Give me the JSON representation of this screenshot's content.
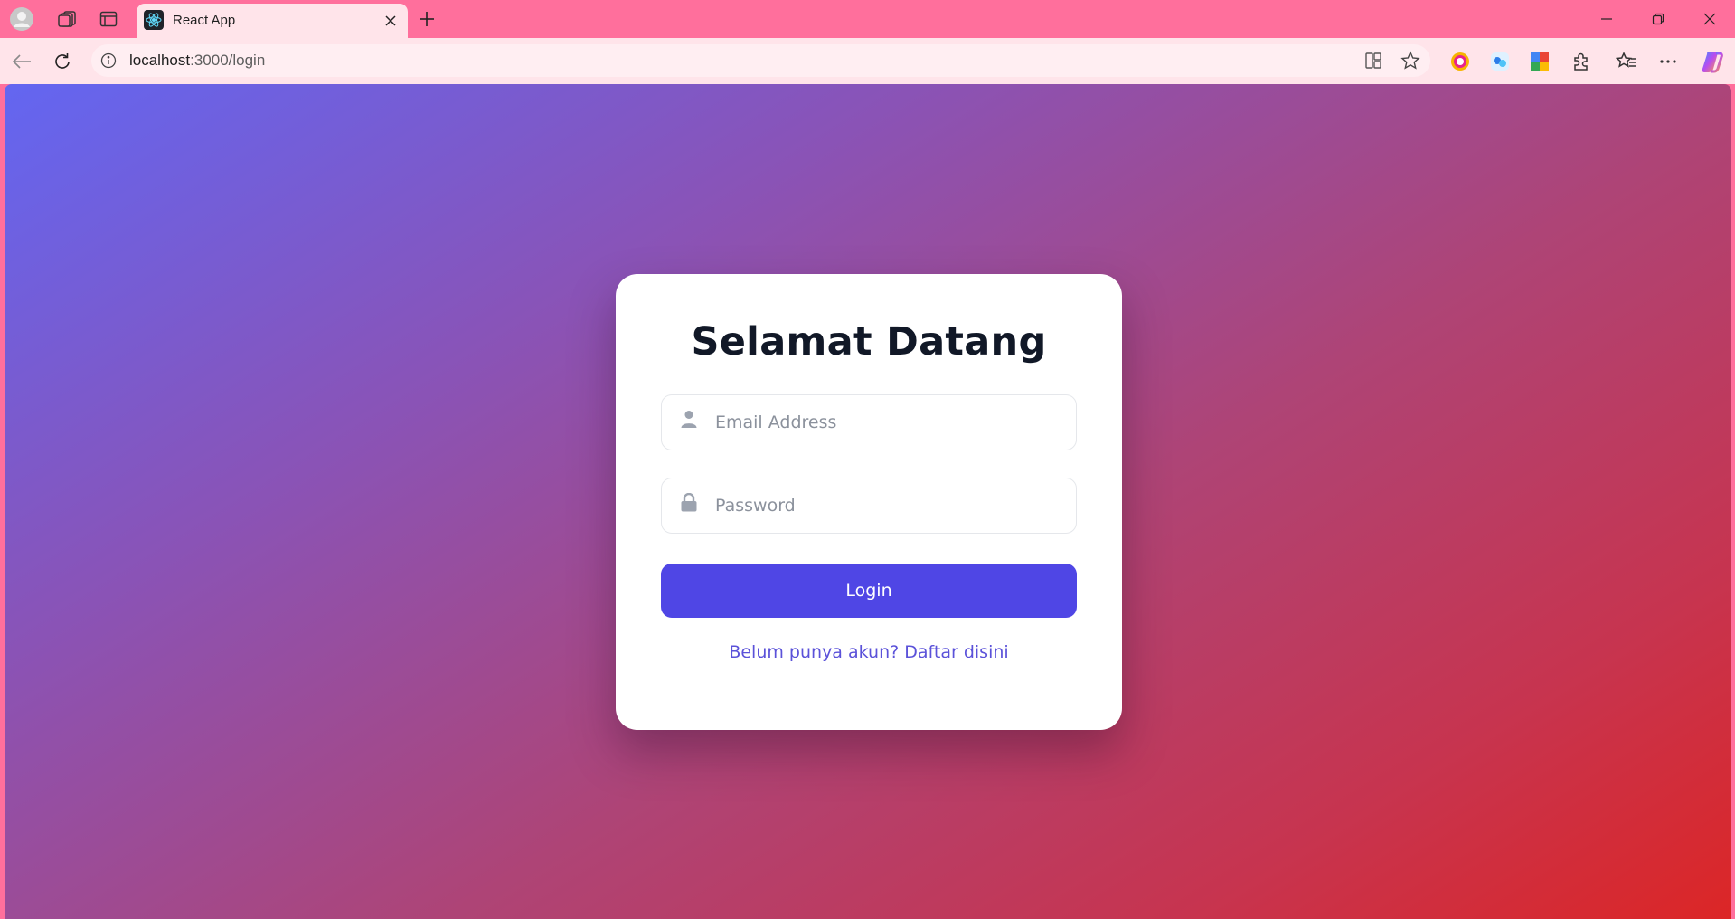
{
  "browser": {
    "tab": {
      "title": "React App",
      "favicon": "react-logo-icon"
    },
    "url": {
      "host": "localhost",
      "path": ":3000/login"
    },
    "icons": {
      "profile": "profile-icon",
      "workspaces": "workspaces-icon",
      "tab_actions": "tab-actions-icon",
      "new_tab": "plus-icon",
      "back": "back-arrow-icon",
      "refresh": "refresh-icon",
      "site_info": "info-icon",
      "split_screen": "split-screen-icon",
      "favorite": "star-icon",
      "extensions": "puzzle-icon",
      "favorites_bar": "favorites-icon",
      "more": "more-icon",
      "copilot": "copilot-icon"
    }
  },
  "login": {
    "title": "Selamat Datang",
    "email_placeholder": "Email Address",
    "password_placeholder": "Password",
    "button_label": "Login",
    "register_link": "Belum punya akun? Daftar disini"
  },
  "colors": {
    "browser_frame": "#ff6f9c",
    "toolbar": "#ffe4ea",
    "gradient_start": "#6366f1",
    "gradient_end": "#dc2626",
    "card": "#ffffff",
    "title_text": "#111827",
    "primary_button": "#4f46e5",
    "link": "#5b52d9",
    "icon_gray": "#9ca3af"
  }
}
